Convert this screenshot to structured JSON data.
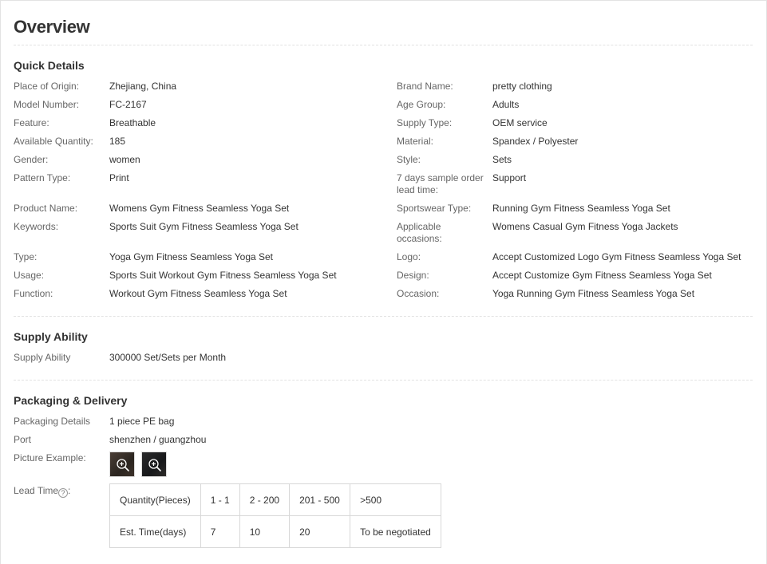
{
  "page": {
    "title": "Overview"
  },
  "quick_details": {
    "title": "Quick Details",
    "left": [
      {
        "label": "Place of Origin:",
        "value": "Zhejiang, China"
      },
      {
        "label": "Model Number:",
        "value": "FC-2167"
      },
      {
        "label": "Feature:",
        "value": "Breathable"
      },
      {
        "label": "Available Quantity:",
        "value": "185"
      },
      {
        "label": "Gender:",
        "value": "women"
      },
      {
        "label": "Pattern Type:",
        "value": "Print"
      },
      {
        "label": "Product Name:",
        "value": "Womens Gym Fitness Seamless Yoga Set"
      },
      {
        "label": "Keywords:",
        "value": "Sports Suit Gym Fitness Seamless Yoga Set"
      },
      {
        "label": "Type:",
        "value": "Yoga Gym Fitness Seamless Yoga Set"
      },
      {
        "label": "Usage:",
        "value": "Sports Suit Workout Gym Fitness Seamless Yoga Set"
      },
      {
        "label": "Function:",
        "value": "Workout Gym Fitness Seamless Yoga Set"
      }
    ],
    "right": [
      {
        "label": "Brand Name:",
        "value": "pretty clothing"
      },
      {
        "label": "Age Group:",
        "value": "Adults"
      },
      {
        "label": "Supply Type:",
        "value": "OEM service"
      },
      {
        "label": "Material:",
        "value": "Spandex / Polyester"
      },
      {
        "label": "Style:",
        "value": "Sets"
      },
      {
        "label": "7 days sample order",
        "label2": "lead time:",
        "value": "Support"
      },
      {
        "label": "Sportswear Type:",
        "value": "Running Gym Fitness Seamless Yoga Set"
      },
      {
        "label": "Applicable",
        "label2": "occasions:",
        "value": "Womens Casual Gym Fitness Yoga Jackets"
      },
      {
        "label": "Logo:",
        "value": "Accept Customized Logo Gym Fitness Seamless Yoga Set"
      },
      {
        "label": "Design:",
        "value": "Accept Customize Gym Fitness Seamless Yoga Set"
      },
      {
        "label": "Occasion:",
        "value": "Yoga Running Gym Fitness Seamless Yoga Set"
      }
    ]
  },
  "supply_ability": {
    "title": "Supply Ability",
    "label": "Supply Ability",
    "value": "300000 Set/Sets per Month"
  },
  "packaging": {
    "title": "Packaging & Delivery",
    "details_label": "Packaging Details",
    "details_value": "1 piece PE bag",
    "port_label": "Port",
    "port_value": "shenzhen / guangzhou",
    "picture_label": "Picture Example:",
    "lead_label": "Lead Time",
    "lead_label_suffix": ":",
    "help_glyph": "?",
    "thumb_icon": "zoom-in-icon",
    "lead_table": {
      "row1": [
        "Quantity(Pieces)",
        "1 - 1",
        "2 - 200",
        "201 - 500",
        ">500"
      ],
      "row2": [
        "Est. Time(days)",
        "7",
        "10",
        "20",
        "To be negotiated"
      ]
    }
  }
}
